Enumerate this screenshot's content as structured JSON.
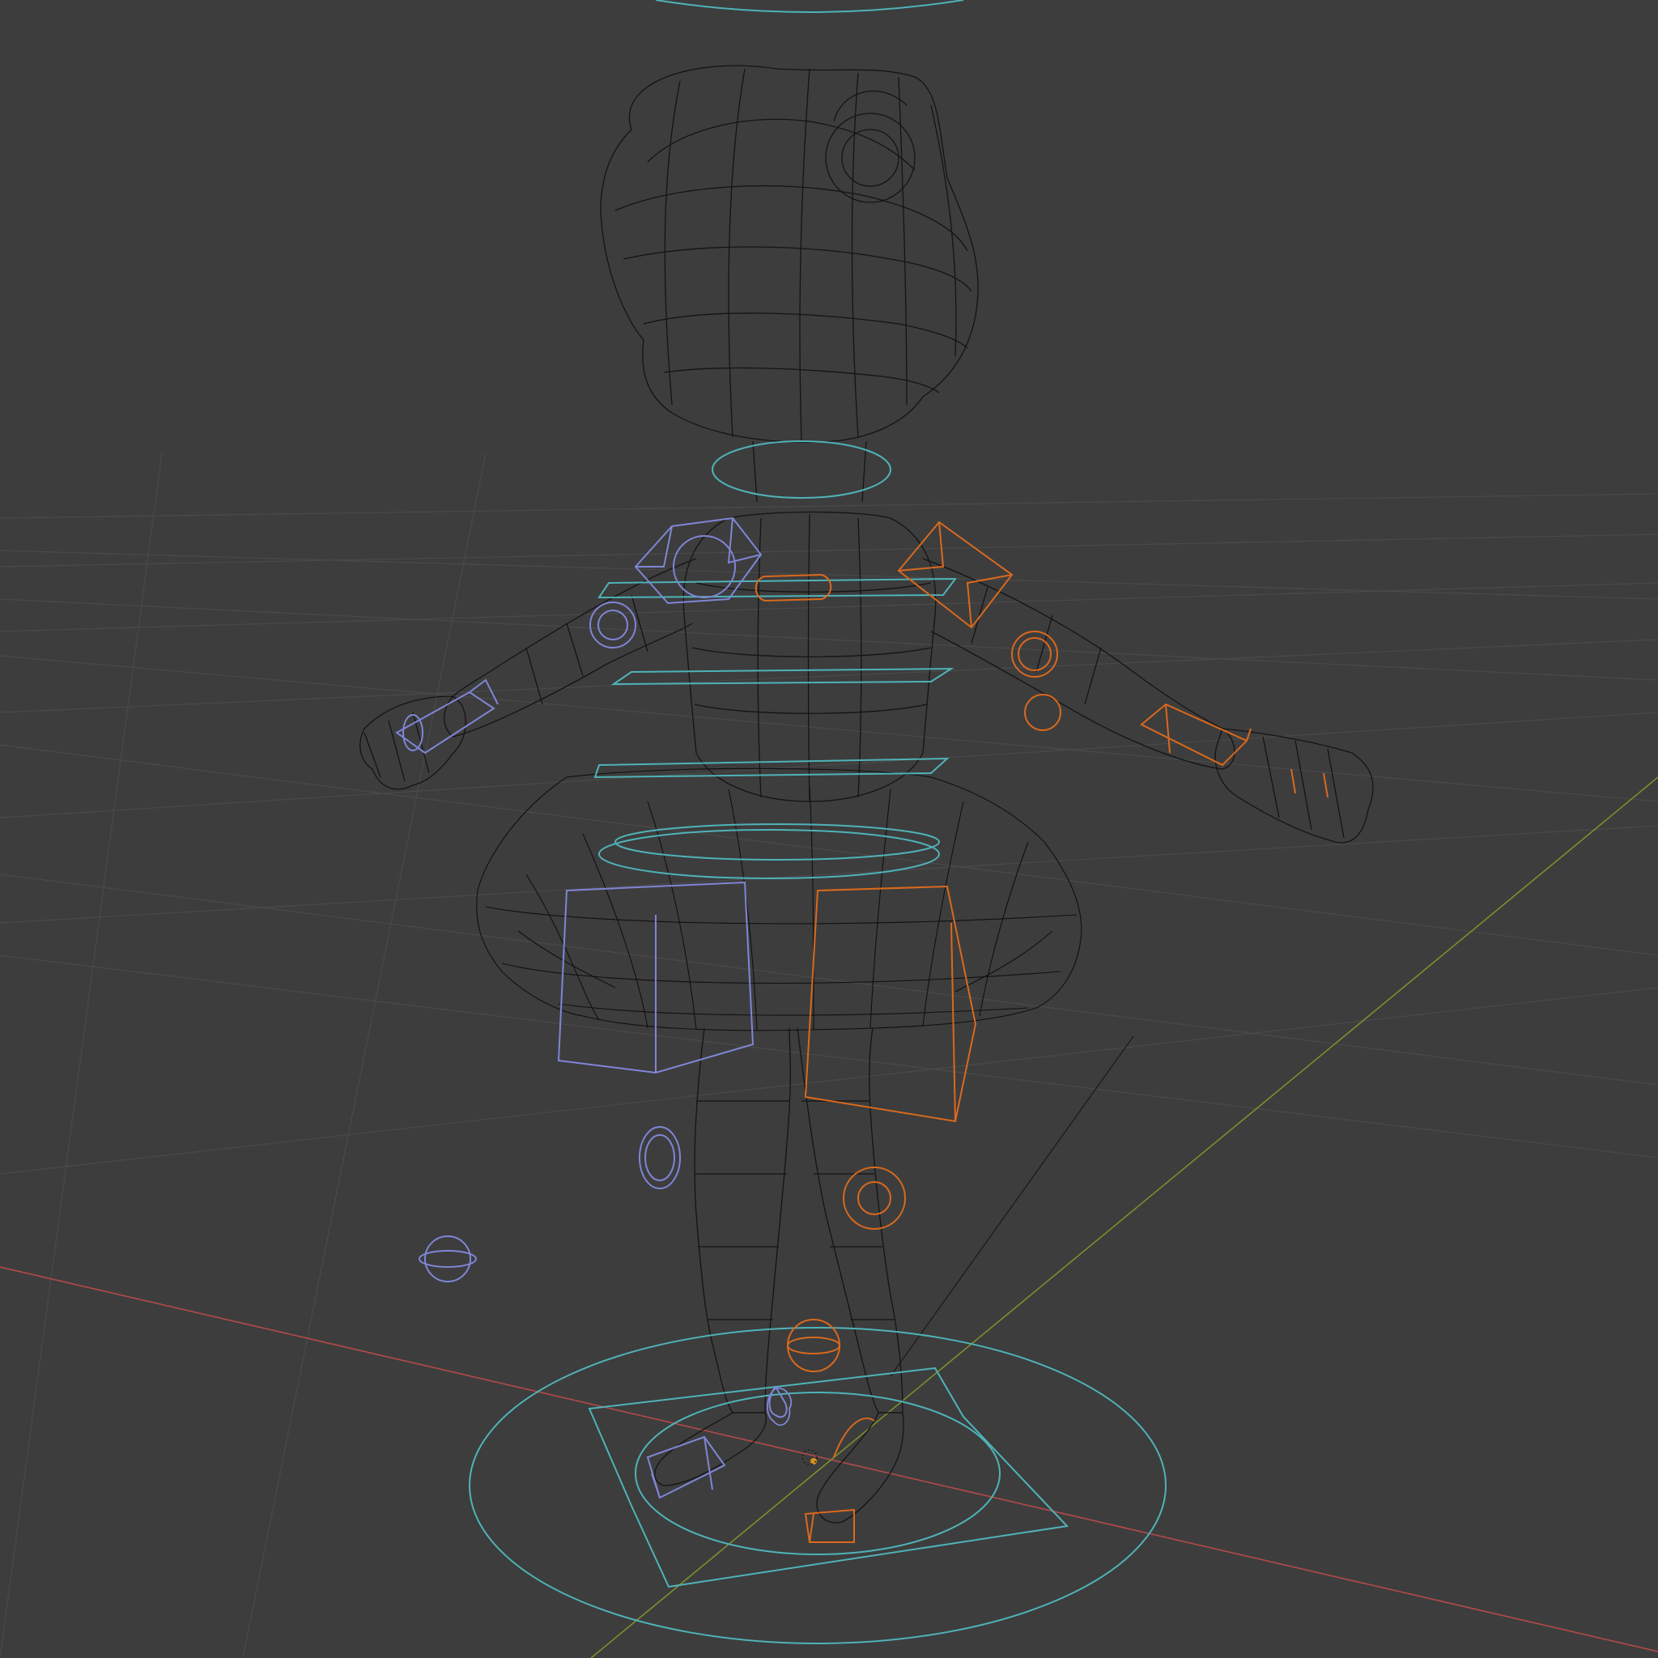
{
  "viewport": {
    "shading_mode": "wireframe",
    "colors": {
      "background": "#3d3d3d",
      "grid": "#4a4a4a",
      "axis_x": "#b34a4a",
      "axis_y": "#7a8f2e",
      "mesh_wire": "#141414",
      "control_spine": "#4fb3b8",
      "control_left": "#7f86d6",
      "control_right": "#d9691e"
    }
  }
}
